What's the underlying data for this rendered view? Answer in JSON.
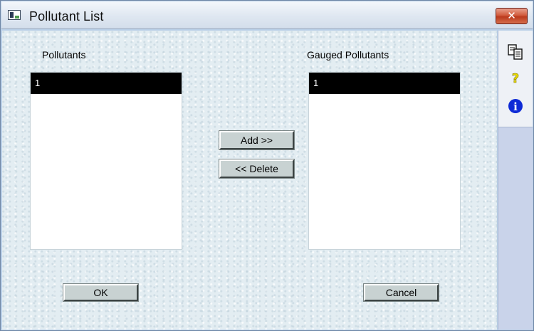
{
  "window": {
    "title": "Pollutant List",
    "close_glyph": "✕"
  },
  "pollutants": {
    "label": "Pollutants",
    "items": [
      "1"
    ]
  },
  "gauged": {
    "label": "Gauged Pollutants",
    "items": [
      "1"
    ]
  },
  "buttons": {
    "add": "Add >>",
    "delete": "<< Delete",
    "ok": "OK",
    "cancel": "Cancel"
  },
  "side_tools": {
    "help_glyph": "?",
    "info_glyph": "i",
    "icons": [
      "copy-icon",
      "help-icon",
      "info-icon"
    ]
  },
  "colors": {
    "selection": "#000000",
    "close_button": "#c8482a",
    "help_icon": "#e6d800",
    "info_icon": "#0d2ad6"
  }
}
